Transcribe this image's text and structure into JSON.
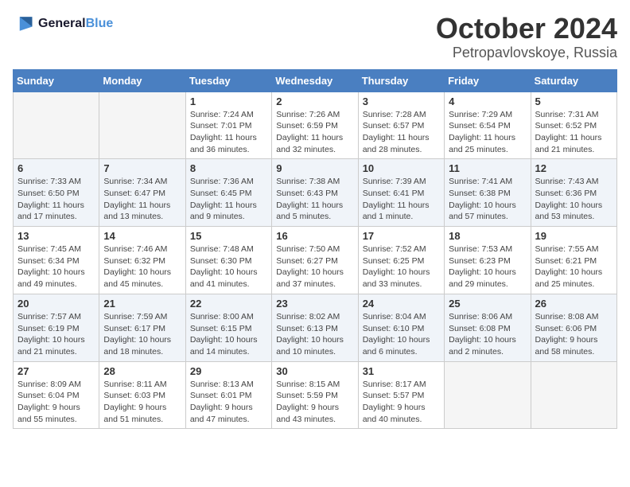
{
  "logo": {
    "line1": "General",
    "line2": "Blue"
  },
  "title": "October 2024",
  "location": "Petropavlovskoye, Russia",
  "days_of_week": [
    "Sunday",
    "Monday",
    "Tuesday",
    "Wednesday",
    "Thursday",
    "Friday",
    "Saturday"
  ],
  "weeks": [
    [
      {
        "day": "",
        "detail": ""
      },
      {
        "day": "",
        "detail": ""
      },
      {
        "day": "1",
        "detail": "Sunrise: 7:24 AM\nSunset: 7:01 PM\nDaylight: 11 hours and 36 minutes."
      },
      {
        "day": "2",
        "detail": "Sunrise: 7:26 AM\nSunset: 6:59 PM\nDaylight: 11 hours and 32 minutes."
      },
      {
        "day": "3",
        "detail": "Sunrise: 7:28 AM\nSunset: 6:57 PM\nDaylight: 11 hours and 28 minutes."
      },
      {
        "day": "4",
        "detail": "Sunrise: 7:29 AM\nSunset: 6:54 PM\nDaylight: 11 hours and 25 minutes."
      },
      {
        "day": "5",
        "detail": "Sunrise: 7:31 AM\nSunset: 6:52 PM\nDaylight: 11 hours and 21 minutes."
      }
    ],
    [
      {
        "day": "6",
        "detail": "Sunrise: 7:33 AM\nSunset: 6:50 PM\nDaylight: 11 hours and 17 minutes."
      },
      {
        "day": "7",
        "detail": "Sunrise: 7:34 AM\nSunset: 6:47 PM\nDaylight: 11 hours and 13 minutes."
      },
      {
        "day": "8",
        "detail": "Sunrise: 7:36 AM\nSunset: 6:45 PM\nDaylight: 11 hours and 9 minutes."
      },
      {
        "day": "9",
        "detail": "Sunrise: 7:38 AM\nSunset: 6:43 PM\nDaylight: 11 hours and 5 minutes."
      },
      {
        "day": "10",
        "detail": "Sunrise: 7:39 AM\nSunset: 6:41 PM\nDaylight: 11 hours and 1 minute."
      },
      {
        "day": "11",
        "detail": "Sunrise: 7:41 AM\nSunset: 6:38 PM\nDaylight: 10 hours and 57 minutes."
      },
      {
        "day": "12",
        "detail": "Sunrise: 7:43 AM\nSunset: 6:36 PM\nDaylight: 10 hours and 53 minutes."
      }
    ],
    [
      {
        "day": "13",
        "detail": "Sunrise: 7:45 AM\nSunset: 6:34 PM\nDaylight: 10 hours and 49 minutes."
      },
      {
        "day": "14",
        "detail": "Sunrise: 7:46 AM\nSunset: 6:32 PM\nDaylight: 10 hours and 45 minutes."
      },
      {
        "day": "15",
        "detail": "Sunrise: 7:48 AM\nSunset: 6:30 PM\nDaylight: 10 hours and 41 minutes."
      },
      {
        "day": "16",
        "detail": "Sunrise: 7:50 AM\nSunset: 6:27 PM\nDaylight: 10 hours and 37 minutes."
      },
      {
        "day": "17",
        "detail": "Sunrise: 7:52 AM\nSunset: 6:25 PM\nDaylight: 10 hours and 33 minutes."
      },
      {
        "day": "18",
        "detail": "Sunrise: 7:53 AM\nSunset: 6:23 PM\nDaylight: 10 hours and 29 minutes."
      },
      {
        "day": "19",
        "detail": "Sunrise: 7:55 AM\nSunset: 6:21 PM\nDaylight: 10 hours and 25 minutes."
      }
    ],
    [
      {
        "day": "20",
        "detail": "Sunrise: 7:57 AM\nSunset: 6:19 PM\nDaylight: 10 hours and 21 minutes."
      },
      {
        "day": "21",
        "detail": "Sunrise: 7:59 AM\nSunset: 6:17 PM\nDaylight: 10 hours and 18 minutes."
      },
      {
        "day": "22",
        "detail": "Sunrise: 8:00 AM\nSunset: 6:15 PM\nDaylight: 10 hours and 14 minutes."
      },
      {
        "day": "23",
        "detail": "Sunrise: 8:02 AM\nSunset: 6:13 PM\nDaylight: 10 hours and 10 minutes."
      },
      {
        "day": "24",
        "detail": "Sunrise: 8:04 AM\nSunset: 6:10 PM\nDaylight: 10 hours and 6 minutes."
      },
      {
        "day": "25",
        "detail": "Sunrise: 8:06 AM\nSunset: 6:08 PM\nDaylight: 10 hours and 2 minutes."
      },
      {
        "day": "26",
        "detail": "Sunrise: 8:08 AM\nSunset: 6:06 PM\nDaylight: 9 hours and 58 minutes."
      }
    ],
    [
      {
        "day": "27",
        "detail": "Sunrise: 8:09 AM\nSunset: 6:04 PM\nDaylight: 9 hours and 55 minutes."
      },
      {
        "day": "28",
        "detail": "Sunrise: 8:11 AM\nSunset: 6:03 PM\nDaylight: 9 hours and 51 minutes."
      },
      {
        "day": "29",
        "detail": "Sunrise: 8:13 AM\nSunset: 6:01 PM\nDaylight: 9 hours and 47 minutes."
      },
      {
        "day": "30",
        "detail": "Sunrise: 8:15 AM\nSunset: 5:59 PM\nDaylight: 9 hours and 43 minutes."
      },
      {
        "day": "31",
        "detail": "Sunrise: 8:17 AM\nSunset: 5:57 PM\nDaylight: 9 hours and 40 minutes."
      },
      {
        "day": "",
        "detail": ""
      },
      {
        "day": "",
        "detail": ""
      }
    ]
  ]
}
